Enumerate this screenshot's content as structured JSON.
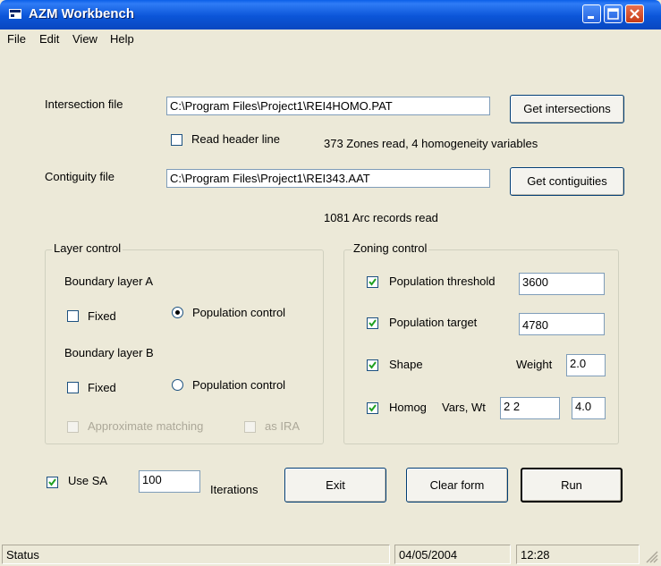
{
  "window": {
    "title": "AZM Workbench"
  },
  "menu": [
    "File",
    "Edit",
    "View",
    "Help"
  ],
  "intersection": {
    "label": "Intersection file",
    "path": "C:\\Program Files\\Project1\\REI4HOMO.PAT",
    "button": "Get intersections",
    "read_header_label": "Read header line",
    "read_header_checked": false,
    "info": "373 Zones read, 4 homogeneity variables"
  },
  "contiguity": {
    "label": "Contiguity file",
    "path": "C:\\Program Files\\Project1\\REI343.AAT",
    "button": "Get contiguities",
    "info": "1081 Arc records read"
  },
  "layer_control": {
    "title": "Layer control",
    "layer_a": {
      "label": "Boundary layer A",
      "fixed_label": "Fixed",
      "fixed_checked": false,
      "pop_label": "Population control",
      "pop_selected": true
    },
    "layer_b": {
      "label": "Boundary layer B",
      "fixed_label": "Fixed",
      "fixed_checked": false,
      "pop_label": "Population control",
      "pop_selected": false
    },
    "approx_label": "Approximate matching",
    "as_ira_label": "as IRA"
  },
  "zoning_control": {
    "title": "Zoning control",
    "pop_threshold": {
      "label": "Population threshold",
      "checked": true,
      "value": "3600"
    },
    "pop_target": {
      "label": "Population target",
      "checked": true,
      "value": "4780"
    },
    "shape": {
      "label": "Shape",
      "checked": true,
      "weight_label": "Weight",
      "weight_value": "2.0"
    },
    "homog": {
      "label": "Homog",
      "vars_label": "Vars, Wt",
      "checked": true,
      "vars_value": "2 2",
      "wt_value": "4.0"
    }
  },
  "bottom": {
    "use_sa_label": "Use SA",
    "use_sa_checked": true,
    "iterations_value": "100",
    "iterations_label": "Iterations",
    "exit": "Exit",
    "clear": "Clear form",
    "run": "Run"
  },
  "status": {
    "text": "Status",
    "date": "04/05/2004",
    "time": "12:28"
  }
}
